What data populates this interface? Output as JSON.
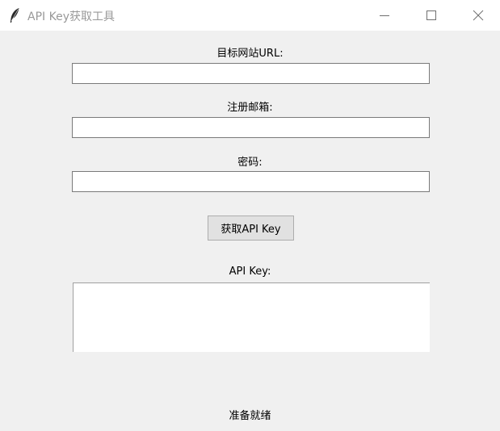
{
  "window": {
    "title": "API Key获取工具",
    "icon": "feather-icon",
    "controls": [
      "minimize-icon",
      "maximize-icon",
      "close-icon"
    ]
  },
  "form": {
    "url_label": "目标网站URL:",
    "url_value": "",
    "email_label": "注册邮箱:",
    "email_value": "",
    "password_label": "密码:",
    "password_value": "",
    "submit_label": "获取API Key"
  },
  "result": {
    "label": "API Key:",
    "value": ""
  },
  "status": {
    "text": "准备就绪"
  }
}
